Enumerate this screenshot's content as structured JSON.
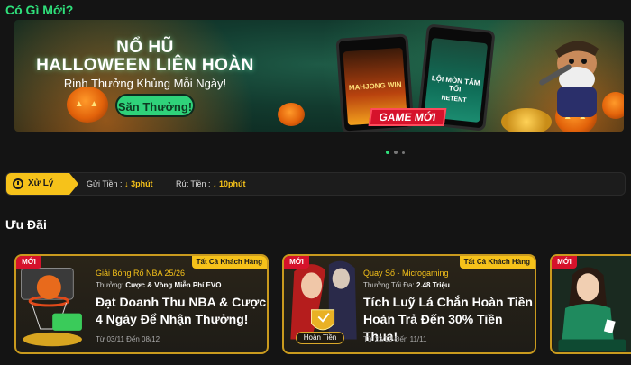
{
  "whats_new": {
    "title": "Có Gì Mới?"
  },
  "banner": {
    "title_line1": "NỔ HŨ",
    "title_line2": "HALLOWEEN LIÊN HOÀN",
    "subtitle": "Rinh Thưởng Khủng Mỗi Ngày!",
    "cta_label": "Săn Thưởng!",
    "badge": "GAME MỚI",
    "phone_left_label": "MAHJONG WIN",
    "phone_right_label": "LỘI MÒN TẤM TỐI",
    "phone_right_sub": "NETENT",
    "slide_count": 3,
    "active_slide": 0
  },
  "status": {
    "tag_label": "Xử Lý",
    "deposit_label": "Gửi Tiền :",
    "deposit_value": "↓ 3phút",
    "withdraw_label": "Rút Tiền :",
    "withdraw_value": "↓ 10phút"
  },
  "promotions": {
    "title": "Ưu Đãi",
    "new_badge": "MỚI",
    "cards": [
      {
        "category": "Giải Bóng Rổ NBA 25/26",
        "reward_label": "Thưởng:",
        "reward_value": "Cược & Vòng Miễn Phí EVO",
        "audience": "Tất Cả Khách Hàng",
        "headline_line1": "Đạt Doanh Thu NBA & Cược",
        "headline_line2": "4 Ngày Để Nhận Thưởng!",
        "date": "Từ 03/11 Đến 08/12"
      },
      {
        "category": "Quay Số - Microgaming",
        "reward_label": "Thưởng Tối Đa:",
        "reward_value": "2.48 Triệu",
        "audience": "Tất Cả Khách Hàng",
        "headline_line1": "Tích Luỹ Lá Chắn Hoàn Tiền",
        "headline_line2": "Hoàn Trả Đến 30% Tiền Thua!",
        "date": "Từ 23/10 Đến 11/11",
        "art_label": "Hoàn Tiền"
      },
      {
        "category": "",
        "audience": ""
      }
    ],
    "slide_count": 3,
    "active_slide": 0
  },
  "colors": {
    "accent_green": "#2fe07b",
    "accent_yellow": "#f6c21a",
    "badge_red": "#d6122b",
    "card_border": "#c99a1e"
  }
}
